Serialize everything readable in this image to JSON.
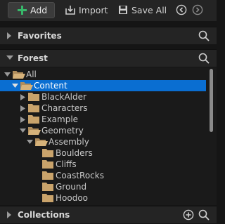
{
  "toolbar": {
    "add_label": "Add",
    "import_label": "Import",
    "save_all_label": "Save All"
  },
  "sections": {
    "favorites": "Favorites",
    "forest": "Forest",
    "collections": "Collections"
  },
  "tree": {
    "items": [
      {
        "label": "All",
        "expanded": true,
        "selected": false
      },
      {
        "label": "Content",
        "expanded": true,
        "selected": true
      },
      {
        "label": "BlackAlder",
        "expanded": false,
        "selected": false
      },
      {
        "label": "Characters",
        "expanded": false,
        "selected": false
      },
      {
        "label": "Example",
        "expanded": false,
        "selected": false
      },
      {
        "label": "Geometry",
        "expanded": true,
        "selected": false
      },
      {
        "label": "Assembly",
        "expanded": true,
        "selected": false
      },
      {
        "label": "Boulders",
        "expanded": false,
        "selected": false
      },
      {
        "label": "Cliffs",
        "expanded": false,
        "selected": false
      },
      {
        "label": "CoastRocks",
        "expanded": false,
        "selected": false
      },
      {
        "label": "Ground",
        "expanded": false,
        "selected": false
      },
      {
        "label": "Hoodoo",
        "expanded": false,
        "selected": false
      }
    ]
  },
  "colors": {
    "accent_selection": "#0a6ed1",
    "add_icon": "#37b86a",
    "folder": "#c9a36b",
    "folder_open": "#d6b27a"
  },
  "icons": [
    "plus-icon",
    "import-icon",
    "save-icon",
    "back-icon",
    "forward-icon",
    "chevron-right-icon",
    "chevron-down-icon",
    "search-icon",
    "folder-icon",
    "folder-open-icon",
    "add-circle-icon"
  ]
}
